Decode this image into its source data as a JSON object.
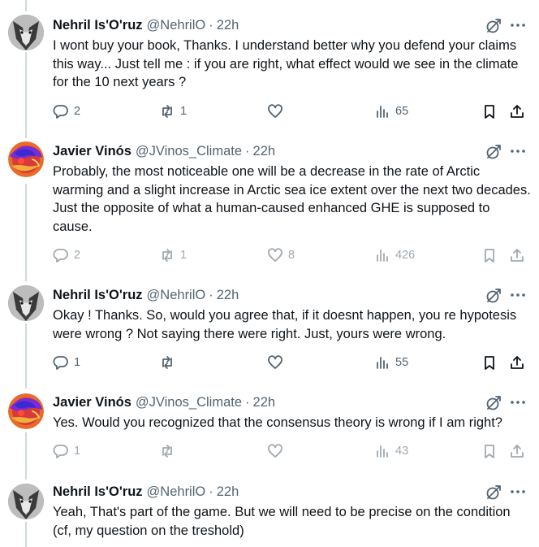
{
  "tweets": [
    {
      "name": "Nehril Is'O'ruz",
      "handle": "@NehrilO",
      "dot": "·",
      "time": "22h",
      "text": "I wont buy your book, Thanks. I understand better why you defend your claims this way... Just tell me : if you are right, what effect would we see in the climate for the 10 next years ?",
      "replies": "2",
      "retweets": "1",
      "likes": "",
      "views": "65"
    },
    {
      "name": "Javier Vinós",
      "handle": "@JVinos_Climate",
      "dot": "·",
      "time": "22h",
      "text": "Probably, the most noticeable one will be a decrease in the rate of Arctic warming and a slight increase in Arctic sea ice extent over the next two decades. Just the opposite of what a human-caused enhanced GHE is supposed to cause.",
      "replies": "2",
      "retweets": "1",
      "likes": "8",
      "views": "426"
    },
    {
      "name": "Nehril Is'O'ruz",
      "handle": "@NehrilO",
      "dot": "·",
      "time": "22h",
      "text": "Okay ! Thanks. So, would you agree that, if it doesnt happen, you re hypotesis were wrong ? Not saying there were right. Just, yours were wrong.",
      "replies": "1",
      "retweets": "",
      "likes": "",
      "views": "55"
    },
    {
      "name": "Javier Vinós",
      "handle": "@JVinos_Climate",
      "dot": "·",
      "time": "22h",
      "text": "Yes. Would you recognized that the consensus theory is wrong if I am right?",
      "replies": "1",
      "retweets": "",
      "likes": "",
      "views": "43"
    },
    {
      "name": "Nehril Is'O'ruz",
      "handle": "@NehrilO",
      "dot": "·",
      "time": "22h",
      "text": "Yeah, That's part of the game. But we will need to be precise on the condition (cf, my question on the treshold)"
    }
  ],
  "colors": {
    "text": "#0f1419",
    "secondary": "#536471",
    "thread_line": "#cfd9de"
  }
}
